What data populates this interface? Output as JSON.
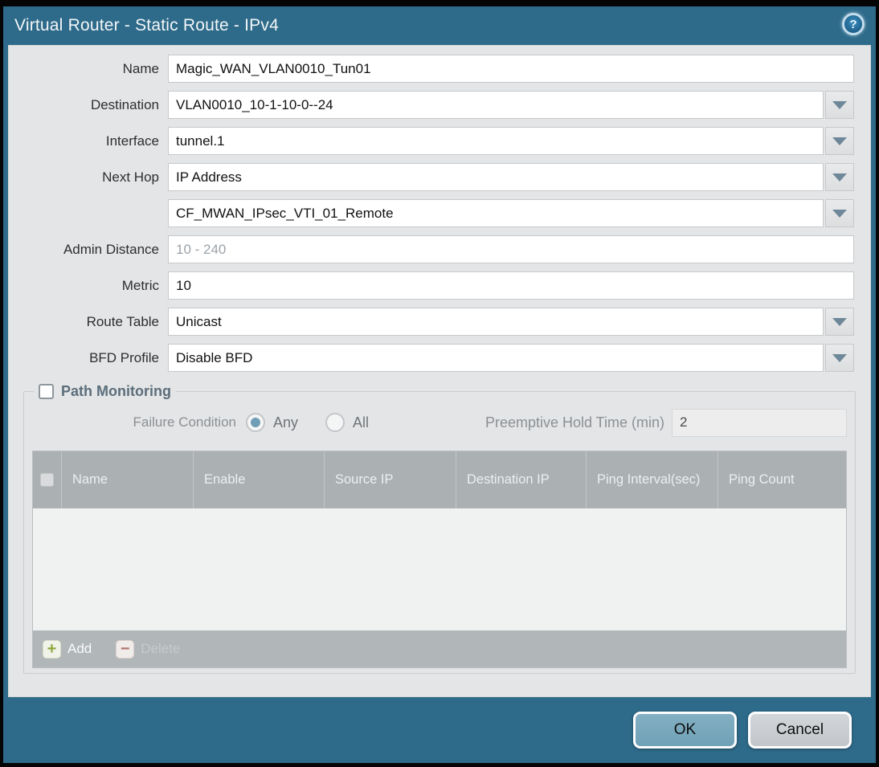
{
  "dialog": {
    "title": "Virtual Router - Static Route - IPv4",
    "help_glyph": "?"
  },
  "form": {
    "name": {
      "label": "Name",
      "value": "Magic_WAN_VLAN0010_Tun01"
    },
    "destination": {
      "label": "Destination",
      "value": "VLAN0010_10-1-10-0--24"
    },
    "interface": {
      "label": "Interface",
      "value": "tunnel.1"
    },
    "next_hop": {
      "label": "Next Hop",
      "value": "IP Address"
    },
    "next_hop_address": {
      "value": "CF_MWAN_IPsec_VTI_01_Remote"
    },
    "admin_distance": {
      "label": "Admin Distance",
      "placeholder": "10 - 240",
      "value": ""
    },
    "metric": {
      "label": "Metric",
      "value": "10"
    },
    "route_table": {
      "label": "Route Table",
      "value": "Unicast"
    },
    "bfd_profile": {
      "label": "BFD Profile",
      "value": "Disable BFD"
    }
  },
  "path_monitoring": {
    "legend": "Path Monitoring",
    "enabled": false,
    "failure_condition": {
      "label": "Failure Condition",
      "any_label": "Any",
      "all_label": "All",
      "selected": "Any"
    },
    "preemptive_hold_time": {
      "label": "Preemptive Hold Time (min)",
      "value": "2"
    },
    "table": {
      "columns": [
        "Name",
        "Enable",
        "Source IP",
        "Destination IP",
        "Ping Interval(sec)",
        "Ping Count"
      ],
      "rows": []
    },
    "toolbar": {
      "add_label": "Add",
      "delete_label": "Delete",
      "add_glyph": "+",
      "delete_glyph": "−"
    }
  },
  "footer": {
    "ok_label": "OK",
    "cancel_label": "Cancel"
  },
  "colors": {
    "frame_teal": "#2E6A89",
    "body_gray": "#E4E5E6",
    "table_header_gray": "#ABB0B3",
    "ok_button": "#77A8BC",
    "add_plus_green": "#8FA83C",
    "delete_minus_red": "#B3766E",
    "radio_selected": "#6F9DB6"
  }
}
